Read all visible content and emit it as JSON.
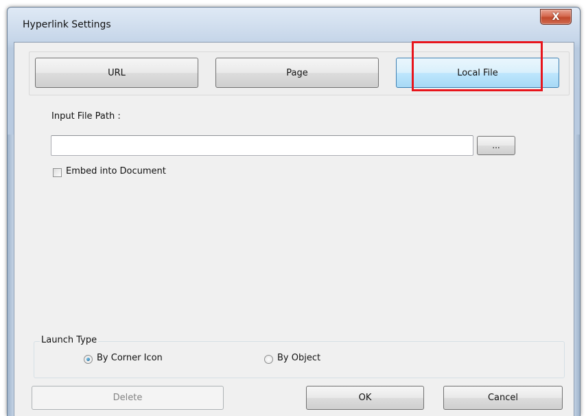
{
  "window": {
    "title": "Hyperlink Settings",
    "close_label": "X"
  },
  "tabs": [
    {
      "label": "URL",
      "active": false
    },
    {
      "label": "Page",
      "active": false
    },
    {
      "label": "Local File",
      "active": true
    }
  ],
  "form": {
    "path_label": "Input File Path :",
    "path_value": "",
    "browse_label": "...",
    "embed_label": "Embed into Document",
    "embed_checked": false
  },
  "launch": {
    "group_label": "Launch Type",
    "options": [
      {
        "label": "By Corner Icon",
        "checked": true
      },
      {
        "label": "By Object",
        "checked": false
      }
    ]
  },
  "footer": {
    "delete_label": "Delete",
    "ok_label": "OK",
    "cancel_label": "Cancel"
  },
  "colors": {
    "highlight": "#e8141b",
    "active_tab": "#bee6fd"
  }
}
